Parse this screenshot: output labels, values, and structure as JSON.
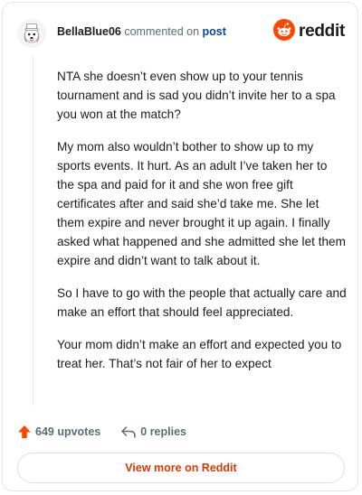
{
  "header": {
    "username": "BellaBlue06",
    "action_text": "commented on",
    "post_link": "post",
    "brand": "reddit"
  },
  "comment": {
    "paragraphs": [
      "NTA she doesn’t even show up to your tennis tournament and is sad you didn’t invite her to a spa you won at the match?",
      "My mom also wouldn’t bother to show up to my sports events. It hurt. As an adult I’ve taken her to the spa and paid for it and she won free gift certificates after and said she’d take me. She let them expire and never brought it up again. I finally asked what happened and she admitted she let them expire and didn’t want to talk about it.",
      "So I have to go with the people that actually care and make an effort that should feel appreciated.",
      "Your mom didn’t make an effort and expected you to treat her. That’s not fair of her to expect"
    ]
  },
  "actions": {
    "upvotes": "649 upvotes",
    "replies": "0 replies"
  },
  "footer": {
    "view_more": "View more on Reddit"
  },
  "colors": {
    "brand_orange": "#ff4500",
    "link_blue": "#0a449b",
    "view_more_text": "#d93a00"
  }
}
